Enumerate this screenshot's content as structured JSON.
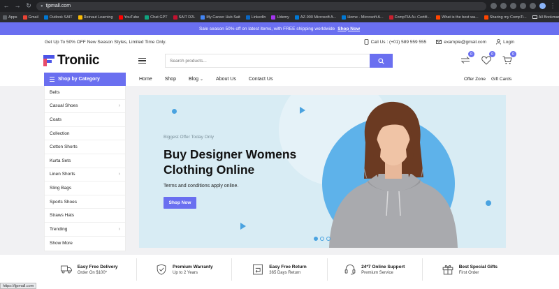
{
  "browser": {
    "url": "tjpmall.com",
    "bookmarks": [
      {
        "label": "Apps",
        "color": "#5f6368"
      },
      {
        "label": "Gmail",
        "color": "#ea4335"
      },
      {
        "label": "Outlook SAIT",
        "color": "#0078d4"
      },
      {
        "label": "Reinaut Learning",
        "color": "#fbbc04"
      },
      {
        "label": "YouTube",
        "color": "#ff0000"
      },
      {
        "label": "Chat GPT",
        "color": "#10a37f"
      },
      {
        "label": "SAIT D2L",
        "color": "#c41230"
      },
      {
        "label": "My Career Hub Sait",
        "color": "#4285f4"
      },
      {
        "label": "LinkedIn",
        "color": "#0a66c2"
      },
      {
        "label": "Udemy",
        "color": "#a435f0"
      },
      {
        "label": "AZ-900 Microsoft A...",
        "color": "#0078d4"
      },
      {
        "label": "Home - Microsoft A...",
        "color": "#0078d4"
      },
      {
        "label": "CompTIA A+ Certifi...",
        "color": "#c8202f"
      },
      {
        "label": "What is the best wa...",
        "color": "#ff4500"
      },
      {
        "label": "Sharing my CompTi...",
        "color": "#ff4500"
      }
    ],
    "all_bookmarks": "All Bookmarks"
  },
  "promo": {
    "text": "Sale season 50% off on latest items, with FREE shipping worldwide",
    "link": "Shop Now"
  },
  "info": {
    "tagline": "Get Up To 50% OFF New Season Styles, Limited Time Only.",
    "call": "Call Us : (+01) 589 559 555",
    "email": "example@gmail.com",
    "login": "Login"
  },
  "header": {
    "logo": "Troniic",
    "search_placeholder": "Search products...",
    "badges": {
      "compare": "0",
      "wishlist": "0",
      "cart": "0"
    }
  },
  "nav": {
    "category_label": "Shop by Category",
    "links": [
      "Home",
      "Shop",
      "Blog",
      "About Us",
      "Contact Us"
    ],
    "right_links": [
      "Offer Zone",
      "Gift Cards"
    ]
  },
  "categories": [
    {
      "label": "Belts",
      "has_sub": false
    },
    {
      "label": "Casual Shoes",
      "has_sub": true
    },
    {
      "label": "Coats",
      "has_sub": false
    },
    {
      "label": "Collection",
      "has_sub": false
    },
    {
      "label": "Cotton Shorts",
      "has_sub": false
    },
    {
      "label": "Kurta Sets",
      "has_sub": false
    },
    {
      "label": "Linen Shorts",
      "has_sub": true
    },
    {
      "label": "Sling Bags",
      "has_sub": false
    },
    {
      "label": "Sports Shoes",
      "has_sub": false
    },
    {
      "label": "Straws Hats",
      "has_sub": false
    },
    {
      "label": "Trending",
      "has_sub": true
    },
    {
      "label": "Show More",
      "has_sub": false
    }
  ],
  "hero": {
    "subtitle": "Biggest Offer Today Only",
    "title_line1": "Buy Designer Womens",
    "title_line2": "Clothing Online",
    "description": "Terms and conditions apply online.",
    "button": "Shop Now",
    "accent_color": "#6a6ff0"
  },
  "features": [
    {
      "icon": "truck-icon",
      "title": "Easy Free Delivery",
      "subtitle": "Order On $100*"
    },
    {
      "icon": "shield-icon",
      "title": "Premium Warranty",
      "subtitle": "Up to 2 Years"
    },
    {
      "icon": "return-icon",
      "title": "Easy Free Return",
      "subtitle": "365 Days Return"
    },
    {
      "icon": "headset-icon",
      "title": "24*7 Online Support",
      "subtitle": "Premium Service"
    },
    {
      "icon": "gift-icon",
      "title": "Best Special Gifts",
      "subtitle": "First Order"
    }
  ],
  "status_url": "https://tjpmall.com"
}
